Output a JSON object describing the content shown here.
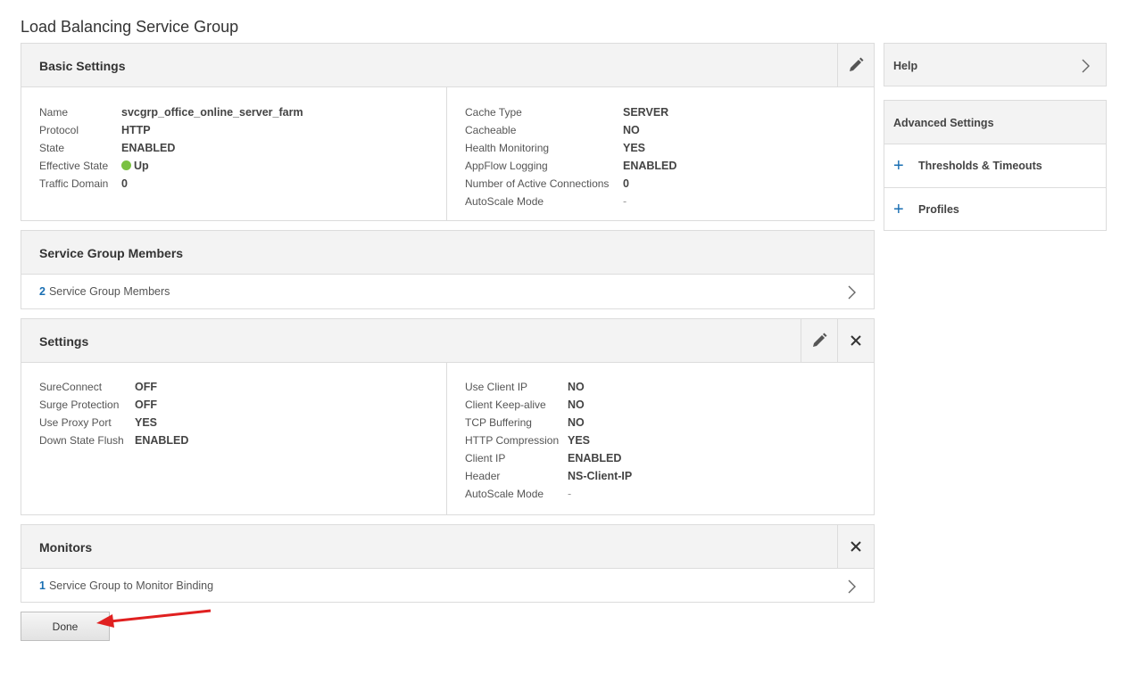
{
  "page": {
    "title": "Load Balancing Service Group"
  },
  "basic": {
    "title": "Basic Settings",
    "left": [
      {
        "key": "Name",
        "value": "svcgrp_office_online_server_farm"
      },
      {
        "key": "Protocol",
        "value": "HTTP"
      },
      {
        "key": "State",
        "value": "ENABLED"
      },
      {
        "key": "Effective State",
        "value": "Up"
      },
      {
        "key": "Traffic Domain",
        "value": "0"
      }
    ],
    "right": [
      {
        "key": "Cache Type",
        "value": "SERVER"
      },
      {
        "key": "Cacheable",
        "value": "NO"
      },
      {
        "key": "Health Monitoring",
        "value": "YES"
      },
      {
        "key": "AppFlow Logging",
        "value": "ENABLED"
      },
      {
        "key": "Number of Active Connections",
        "value": "0"
      },
      {
        "key": "AutoScale Mode",
        "value": "-"
      }
    ]
  },
  "members": {
    "title": "Service Group Members",
    "count": "2",
    "label": "Service Group Members"
  },
  "settings": {
    "title": "Settings",
    "left": [
      {
        "key": "SureConnect",
        "value": "OFF"
      },
      {
        "key": "Surge Protection",
        "value": "OFF"
      },
      {
        "key": "Use Proxy Port",
        "value": "YES"
      },
      {
        "key": "Down State Flush",
        "value": "ENABLED"
      }
    ],
    "right": [
      {
        "key": "Use Client IP",
        "value": "NO"
      },
      {
        "key": "Client Keep-alive",
        "value": "NO"
      },
      {
        "key": "TCP Buffering",
        "value": "NO"
      },
      {
        "key": "HTTP Compression",
        "value": "YES"
      },
      {
        "key": "Client IP",
        "value": "ENABLED"
      },
      {
        "key": "Header",
        "value": "NS-Client-IP"
      },
      {
        "key": "AutoScale Mode",
        "value": "-"
      }
    ]
  },
  "monitors": {
    "title": "Monitors",
    "count": "1",
    "label": "Service Group to Monitor Binding"
  },
  "done_label": "Done",
  "sidebar": {
    "help": "Help",
    "advanced_title": "Advanced Settings",
    "items": [
      {
        "label": "Thresholds & Timeouts"
      },
      {
        "label": "Profiles"
      }
    ]
  },
  "colors": {
    "accent": "#1a6fb3",
    "status_up": "#7ac142",
    "annotation_arrow": "#e02020"
  },
  "icons": {
    "edit": "pencil-icon",
    "close": "close-icon",
    "next": "chevron-right-icon",
    "add": "plus-icon"
  }
}
